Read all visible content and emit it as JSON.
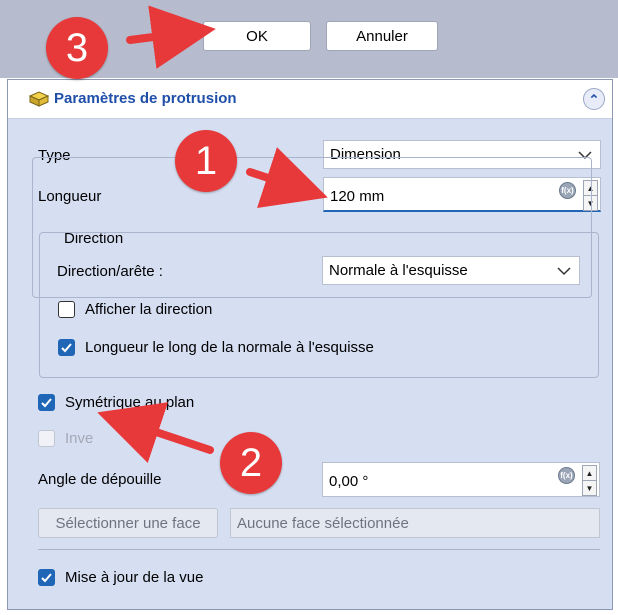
{
  "dialog": {
    "ok_label": "OK",
    "cancel_label": "Annuler"
  },
  "panel": {
    "title": "Paramètres de protrusion",
    "type_label": "Type",
    "type_value": "Dimension",
    "length_label": "Longueur",
    "length_value": "120 mm",
    "direction_group_title": "Direction",
    "direction_edge_label": "Direction/arête :",
    "direction_edge_value": "Normale à l'esquisse",
    "show_direction_label": "Afficher la direction",
    "show_direction_checked": false,
    "length_along_normal_label": "Longueur le long de la normale à l'esquisse",
    "length_along_normal_checked": true,
    "symmetric_label": "Symétrique au plan",
    "symmetric_checked": true,
    "reversed_label": "Inve",
    "reversed_enabled": false,
    "draft_angle_label": "Angle de dépouille",
    "draft_angle_value": "0,00 °",
    "select_face_label": "Sélectionner une face",
    "face_status": "Aucune face sélectionnée",
    "update_view_label": "Mise à jour de la vue",
    "update_view_checked": true
  },
  "annotations": {
    "badge1": "1",
    "badge2": "2",
    "badge3": "3"
  },
  "colors": {
    "panel_bg": "#d6def2",
    "title_blue": "#1f4fa9",
    "checkbox_blue": "#1f66b7",
    "badge_red": "#e8393a",
    "header_bg": "#b6bccd"
  }
}
